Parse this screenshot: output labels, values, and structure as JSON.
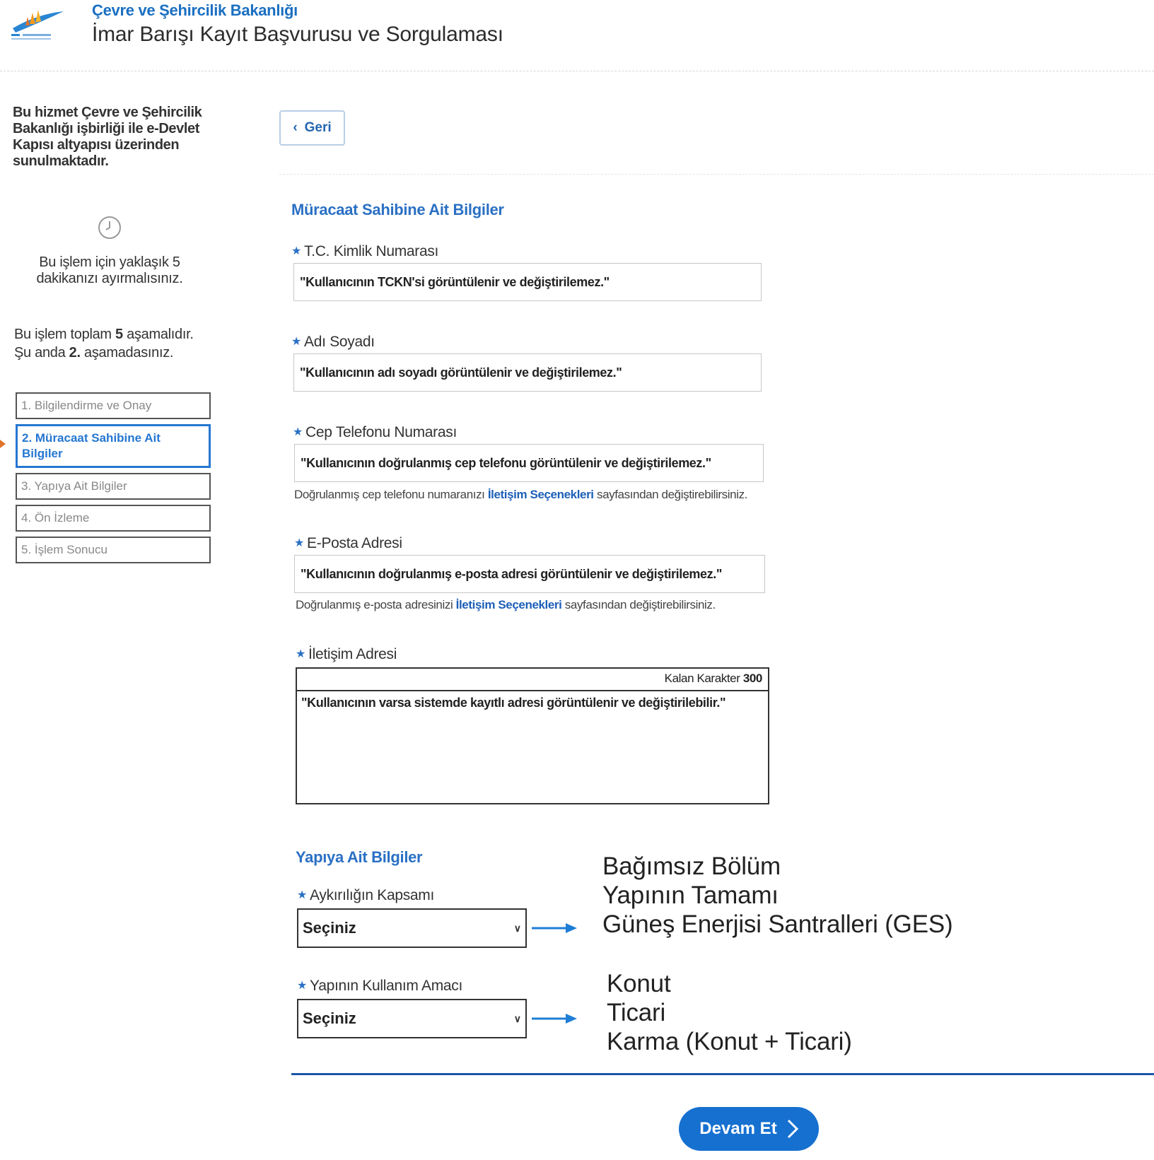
{
  "header": {
    "ministry": "Çevre ve Şehircilik Bakanlığı",
    "app_title": "İmar Barışı Kayıt Başvurusu ve Sorgulaması"
  },
  "sidebar": {
    "intro": "Bu hizmet Çevre ve Şehircilik Bakanlığı işbirliği ile e-Devlet Kapısı altyapısı üzerinden sunulmaktadır.",
    "duration": "Bu işlem için yaklaşık 5 dakikanızı ayırmalısınız.",
    "stage_line1_pre": "Bu işlem toplam ",
    "stage_total": "5",
    "stage_line1_post": " aşamalıdır.",
    "stage_line2_pre": "Şu anda ",
    "stage_current": "2.",
    "stage_line2_post": " aşamadasınız.",
    "steps": [
      {
        "label": "1. Bilgilendirme ve Onay",
        "active": false
      },
      {
        "label": "2. Müracaat Sahibine Ait Bilgiler",
        "active": true
      },
      {
        "label": "3. Yapıya Ait Bilgiler",
        "active": false
      },
      {
        "label": "4. Ön İzleme",
        "active": false
      },
      {
        "label": "5. İşlem Sonucu",
        "active": false
      }
    ]
  },
  "main": {
    "back_label": "Geri",
    "applicant_section": "Müracaat Sahibine Ait Bilgiler",
    "tckn_label": "T.C. Kimlik Numarası",
    "tckn_value": "\"Kullanıcının TCKN'si görüntülenir ve değiştirilemez.\"",
    "name_label": "Adı Soyadı",
    "name_value": "\"Kullanıcının adı soyadı görüntülenir ve değiştirilemez.\"",
    "phone_label": "Cep Telefonu Numarası",
    "phone_value": "\"Kullanıcının doğrulanmış cep telefonu görüntülenir ve değiştirilemez.\"",
    "phone_help_pre": "Doğrulanmış cep telefonu numaranızı ",
    "phone_help_link": "İletişim Seçenekleri",
    "phone_help_post": " sayfasından değiştirebilirsiniz.",
    "email_label": "E-Posta Adresi",
    "email_value": "\"Kullanıcının doğrulanmış e-posta adresi görüntülenir ve değiştirilemez.\"",
    "email_help_pre": "Doğrulanmış e-posta adresinizi ",
    "email_help_link": "İletişim Seçenekleri",
    "email_help_post": " sayfasından değiştirebilirsiniz.",
    "address_label": "İletişim Adresi",
    "remaining_label": "Kalan Karakter ",
    "remaining_count": "300",
    "address_value": "\"Kullanıcının varsa sistemde kayıtlı adresi görüntülenir ve değiştirilebilir.\"",
    "building_section": "Yapıya Ait Bilgiler",
    "scope_label": "Aykırılığın Kapsamı",
    "scope_selected": "Seçiniz",
    "scope_options": [
      "Bağımsız Bölüm",
      "Yapının Tamamı",
      "Güneş Enerjisi Santralleri (GES)"
    ],
    "usage_label": "Yapının Kullanım Amacı",
    "usage_selected": "Seçiniz",
    "usage_options": [
      "Konut",
      "Ticari",
      "Karma (Konut + Ticari)"
    ],
    "continue_label": "Devam Et"
  },
  "colors": {
    "accent": "#2a70c4",
    "button": "#1670d0",
    "arrow": "#1e7ed6"
  }
}
